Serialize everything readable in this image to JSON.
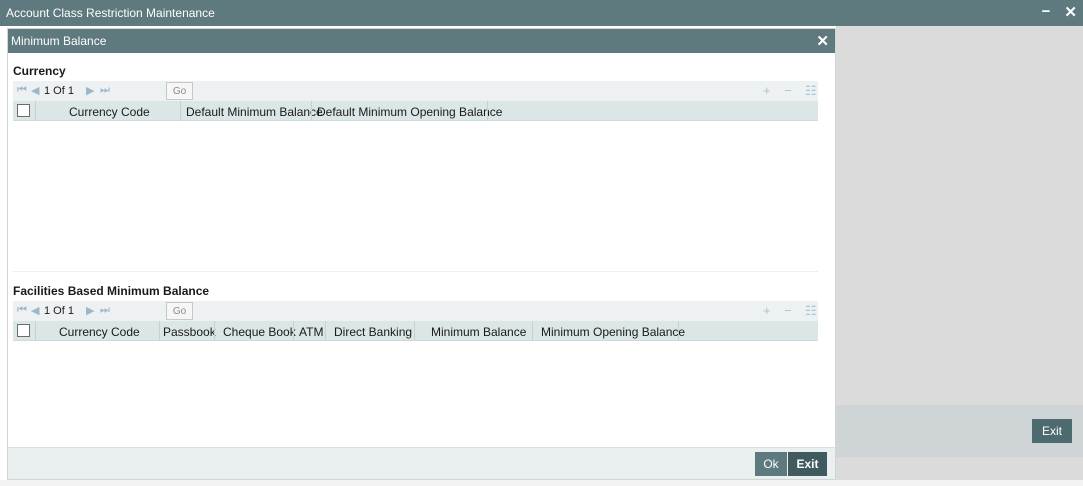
{
  "window": {
    "title": "Account Class Restriction Maintenance",
    "minimize_glyph": "−",
    "close_glyph": "✕"
  },
  "background": {
    "exit_label": "Exit"
  },
  "modal": {
    "title": "Minimum Balance",
    "close_glyph": "✕",
    "ok_label": "Ok",
    "exit_label": "Exit"
  },
  "currency_section": {
    "title": "Currency",
    "pager": {
      "first_icon": "first-page-icon",
      "prev_icon": "prev-page-icon",
      "page_text": "1 Of 1",
      "next_icon": "next-page-icon",
      "last_icon": "last-page-icon",
      "go_label": "Go",
      "add_glyph": "+",
      "remove_glyph": "−",
      "view_glyph": "☷"
    },
    "columns": [
      "Currency Code",
      "Default Minimum Balance",
      "Default Minimum Opening Balance"
    ]
  },
  "facilities_section": {
    "title": "Facilities Based Minimum Balance",
    "pager": {
      "page_text": "1 Of 1",
      "go_label": "Go",
      "add_glyph": "+",
      "remove_glyph": "−",
      "view_glyph": "☷"
    },
    "columns": [
      "Currency Code",
      "Passbook",
      "Cheque Book",
      "ATM",
      "Direct Banking",
      "Minimum Balance",
      "Minimum Opening Balance"
    ]
  },
  "colors": {
    "titlebar": "#5e7a7e",
    "grid_header": "#dbe6e6",
    "pager_bg": "#edf1f1",
    "button_dark": "#3f5b5e"
  }
}
